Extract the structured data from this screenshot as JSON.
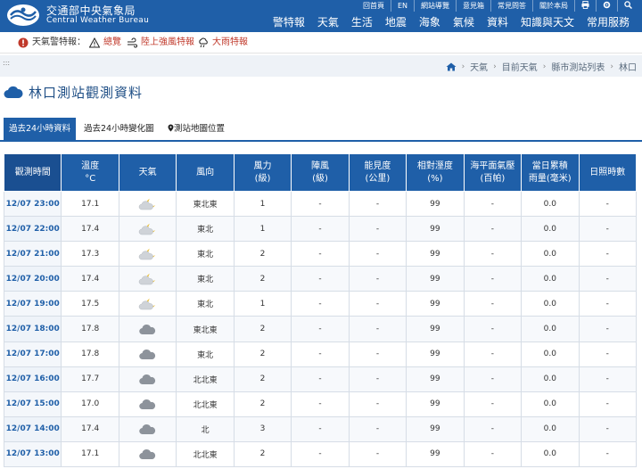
{
  "header": {
    "agency_cn": "交通部中央氣象局",
    "agency_en": "Central Weather Bureau",
    "top_links": [
      "回首頁",
      "EN",
      "網站導覽",
      "意見箱",
      "常見問答",
      "關於本局"
    ],
    "top_icons": [
      "print-icon",
      "gear-icon",
      "search-icon"
    ],
    "nav": [
      "警特報",
      "天氣",
      "生活",
      "地震",
      "海象",
      "氣候",
      "資料",
      "知識與天文",
      "常用服務"
    ]
  },
  "warnings": {
    "label": "天氣警特報：",
    "items": [
      {
        "text": "總覽",
        "icon": "warning-triangle-icon"
      },
      {
        "text": "陸上強風特報",
        "icon": "wind-icon"
      },
      {
        "text": "大雨特報",
        "icon": "rain-cloud-icon"
      }
    ]
  },
  "breadcrumb": [
    "天氣",
    "目前天氣",
    "縣市測站列表",
    "林口"
  ],
  "page_title": "林口測站觀測資料",
  "tabs": [
    "過去24小時資料",
    "過去24小時變化圖",
    "測站地圖位置"
  ],
  "table": {
    "headers": [
      "觀測時間",
      "溫度\n°C",
      "天氣",
      "風向",
      "風力\n(級)",
      "陣風\n(級)",
      "能見度\n(公里)",
      "相對溼度\n(%)",
      "海平面氣壓\n(百帕)",
      "當日累積\n雨量(毫米)",
      "日照時數"
    ],
    "rows": [
      {
        "time": "12/07 23:00",
        "temp": "17.1",
        "wx": "partly-cloudy-night",
        "dir": "東北東",
        "force": "1",
        "gust": "-",
        "vis": "-",
        "rh": "99",
        "press": "-",
        "rain": "0.0",
        "sun": "-"
      },
      {
        "time": "12/07 22:00",
        "temp": "17.4",
        "wx": "partly-cloudy-night",
        "dir": "東北",
        "force": "1",
        "gust": "-",
        "vis": "-",
        "rh": "99",
        "press": "-",
        "rain": "0.0",
        "sun": "-"
      },
      {
        "time": "12/07 21:00",
        "temp": "17.3",
        "wx": "partly-cloudy-night",
        "dir": "東北",
        "force": "2",
        "gust": "-",
        "vis": "-",
        "rh": "99",
        "press": "-",
        "rain": "0.0",
        "sun": "-"
      },
      {
        "time": "12/07 20:00",
        "temp": "17.4",
        "wx": "partly-cloudy-night",
        "dir": "東北",
        "force": "2",
        "gust": "-",
        "vis": "-",
        "rh": "99",
        "press": "-",
        "rain": "0.0",
        "sun": "-"
      },
      {
        "time": "12/07 19:00",
        "temp": "17.5",
        "wx": "partly-cloudy-night",
        "dir": "東北",
        "force": "1",
        "gust": "-",
        "vis": "-",
        "rh": "99",
        "press": "-",
        "rain": "0.0",
        "sun": "-"
      },
      {
        "time": "12/07 18:00",
        "temp": "17.8",
        "wx": "cloudy",
        "dir": "東北東",
        "force": "2",
        "gust": "-",
        "vis": "-",
        "rh": "99",
        "press": "-",
        "rain": "0.0",
        "sun": "-"
      },
      {
        "time": "12/07 17:00",
        "temp": "17.8",
        "wx": "cloudy",
        "dir": "東北",
        "force": "2",
        "gust": "-",
        "vis": "-",
        "rh": "99",
        "press": "-",
        "rain": "0.0",
        "sun": "-"
      },
      {
        "time": "12/07 16:00",
        "temp": "17.7",
        "wx": "cloudy",
        "dir": "北北東",
        "force": "2",
        "gust": "-",
        "vis": "-",
        "rh": "99",
        "press": "-",
        "rain": "0.0",
        "sun": "-"
      },
      {
        "time": "12/07 15:00",
        "temp": "17.0",
        "wx": "cloudy",
        "dir": "北北東",
        "force": "2",
        "gust": "-",
        "vis": "-",
        "rh": "99",
        "press": "-",
        "rain": "0.0",
        "sun": "-"
      },
      {
        "time": "12/07 14:00",
        "temp": "17.4",
        "wx": "cloudy",
        "dir": "北",
        "force": "3",
        "gust": "-",
        "vis": "-",
        "rh": "99",
        "press": "-",
        "rain": "0.0",
        "sun": "-"
      },
      {
        "time": "12/07 13:00",
        "temp": "17.1",
        "wx": "cloudy",
        "dir": "北北東",
        "force": "2",
        "gust": "-",
        "vis": "-",
        "rh": "99",
        "press": "-",
        "rain": "0.0",
        "sun": "-"
      }
    ]
  },
  "colors": {
    "brand": "#1f5fa8",
    "warning": "#c0392b",
    "breadcrumb_bg": "#eef2f7"
  }
}
